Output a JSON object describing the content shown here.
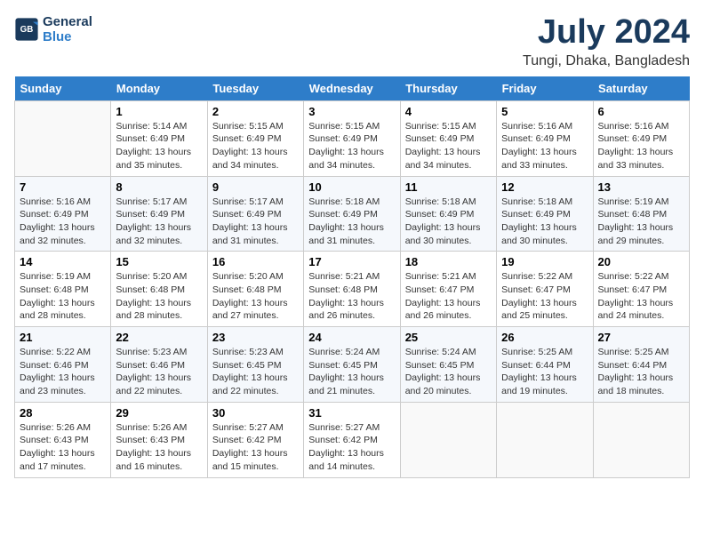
{
  "header": {
    "logo_line1": "General",
    "logo_line2": "Blue",
    "month_title": "July 2024",
    "location": "Tungi, Dhaka, Bangladesh"
  },
  "weekdays": [
    "Sunday",
    "Monday",
    "Tuesday",
    "Wednesday",
    "Thursday",
    "Friday",
    "Saturday"
  ],
  "weeks": [
    [
      {
        "num": "",
        "sunrise": "",
        "sunset": "",
        "daylight": ""
      },
      {
        "num": "1",
        "sunrise": "Sunrise: 5:14 AM",
        "sunset": "Sunset: 6:49 PM",
        "daylight": "Daylight: 13 hours and 35 minutes."
      },
      {
        "num": "2",
        "sunrise": "Sunrise: 5:15 AM",
        "sunset": "Sunset: 6:49 PM",
        "daylight": "Daylight: 13 hours and 34 minutes."
      },
      {
        "num": "3",
        "sunrise": "Sunrise: 5:15 AM",
        "sunset": "Sunset: 6:49 PM",
        "daylight": "Daylight: 13 hours and 34 minutes."
      },
      {
        "num": "4",
        "sunrise": "Sunrise: 5:15 AM",
        "sunset": "Sunset: 6:49 PM",
        "daylight": "Daylight: 13 hours and 34 minutes."
      },
      {
        "num": "5",
        "sunrise": "Sunrise: 5:16 AM",
        "sunset": "Sunset: 6:49 PM",
        "daylight": "Daylight: 13 hours and 33 minutes."
      },
      {
        "num": "6",
        "sunrise": "Sunrise: 5:16 AM",
        "sunset": "Sunset: 6:49 PM",
        "daylight": "Daylight: 13 hours and 33 minutes."
      }
    ],
    [
      {
        "num": "7",
        "sunrise": "Sunrise: 5:16 AM",
        "sunset": "Sunset: 6:49 PM",
        "daylight": "Daylight: 13 hours and 32 minutes."
      },
      {
        "num": "8",
        "sunrise": "Sunrise: 5:17 AM",
        "sunset": "Sunset: 6:49 PM",
        "daylight": "Daylight: 13 hours and 32 minutes."
      },
      {
        "num": "9",
        "sunrise": "Sunrise: 5:17 AM",
        "sunset": "Sunset: 6:49 PM",
        "daylight": "Daylight: 13 hours and 31 minutes."
      },
      {
        "num": "10",
        "sunrise": "Sunrise: 5:18 AM",
        "sunset": "Sunset: 6:49 PM",
        "daylight": "Daylight: 13 hours and 31 minutes."
      },
      {
        "num": "11",
        "sunrise": "Sunrise: 5:18 AM",
        "sunset": "Sunset: 6:49 PM",
        "daylight": "Daylight: 13 hours and 30 minutes."
      },
      {
        "num": "12",
        "sunrise": "Sunrise: 5:18 AM",
        "sunset": "Sunset: 6:49 PM",
        "daylight": "Daylight: 13 hours and 30 minutes."
      },
      {
        "num": "13",
        "sunrise": "Sunrise: 5:19 AM",
        "sunset": "Sunset: 6:48 PM",
        "daylight": "Daylight: 13 hours and 29 minutes."
      }
    ],
    [
      {
        "num": "14",
        "sunrise": "Sunrise: 5:19 AM",
        "sunset": "Sunset: 6:48 PM",
        "daylight": "Daylight: 13 hours and 28 minutes."
      },
      {
        "num": "15",
        "sunrise": "Sunrise: 5:20 AM",
        "sunset": "Sunset: 6:48 PM",
        "daylight": "Daylight: 13 hours and 28 minutes."
      },
      {
        "num": "16",
        "sunrise": "Sunrise: 5:20 AM",
        "sunset": "Sunset: 6:48 PM",
        "daylight": "Daylight: 13 hours and 27 minutes."
      },
      {
        "num": "17",
        "sunrise": "Sunrise: 5:21 AM",
        "sunset": "Sunset: 6:48 PM",
        "daylight": "Daylight: 13 hours and 26 minutes."
      },
      {
        "num": "18",
        "sunrise": "Sunrise: 5:21 AM",
        "sunset": "Sunset: 6:47 PM",
        "daylight": "Daylight: 13 hours and 26 minutes."
      },
      {
        "num": "19",
        "sunrise": "Sunrise: 5:22 AM",
        "sunset": "Sunset: 6:47 PM",
        "daylight": "Daylight: 13 hours and 25 minutes."
      },
      {
        "num": "20",
        "sunrise": "Sunrise: 5:22 AM",
        "sunset": "Sunset: 6:47 PM",
        "daylight": "Daylight: 13 hours and 24 minutes."
      }
    ],
    [
      {
        "num": "21",
        "sunrise": "Sunrise: 5:22 AM",
        "sunset": "Sunset: 6:46 PM",
        "daylight": "Daylight: 13 hours and 23 minutes."
      },
      {
        "num": "22",
        "sunrise": "Sunrise: 5:23 AM",
        "sunset": "Sunset: 6:46 PM",
        "daylight": "Daylight: 13 hours and 22 minutes."
      },
      {
        "num": "23",
        "sunrise": "Sunrise: 5:23 AM",
        "sunset": "Sunset: 6:45 PM",
        "daylight": "Daylight: 13 hours and 22 minutes."
      },
      {
        "num": "24",
        "sunrise": "Sunrise: 5:24 AM",
        "sunset": "Sunset: 6:45 PM",
        "daylight": "Daylight: 13 hours and 21 minutes."
      },
      {
        "num": "25",
        "sunrise": "Sunrise: 5:24 AM",
        "sunset": "Sunset: 6:45 PM",
        "daylight": "Daylight: 13 hours and 20 minutes."
      },
      {
        "num": "26",
        "sunrise": "Sunrise: 5:25 AM",
        "sunset": "Sunset: 6:44 PM",
        "daylight": "Daylight: 13 hours and 19 minutes."
      },
      {
        "num": "27",
        "sunrise": "Sunrise: 5:25 AM",
        "sunset": "Sunset: 6:44 PM",
        "daylight": "Daylight: 13 hours and 18 minutes."
      }
    ],
    [
      {
        "num": "28",
        "sunrise": "Sunrise: 5:26 AM",
        "sunset": "Sunset: 6:43 PM",
        "daylight": "Daylight: 13 hours and 17 minutes."
      },
      {
        "num": "29",
        "sunrise": "Sunrise: 5:26 AM",
        "sunset": "Sunset: 6:43 PM",
        "daylight": "Daylight: 13 hours and 16 minutes."
      },
      {
        "num": "30",
        "sunrise": "Sunrise: 5:27 AM",
        "sunset": "Sunset: 6:42 PM",
        "daylight": "Daylight: 13 hours and 15 minutes."
      },
      {
        "num": "31",
        "sunrise": "Sunrise: 5:27 AM",
        "sunset": "Sunset: 6:42 PM",
        "daylight": "Daylight: 13 hours and 14 minutes."
      },
      {
        "num": "",
        "sunrise": "",
        "sunset": "",
        "daylight": ""
      },
      {
        "num": "",
        "sunrise": "",
        "sunset": "",
        "daylight": ""
      },
      {
        "num": "",
        "sunrise": "",
        "sunset": "",
        "daylight": ""
      }
    ]
  ]
}
